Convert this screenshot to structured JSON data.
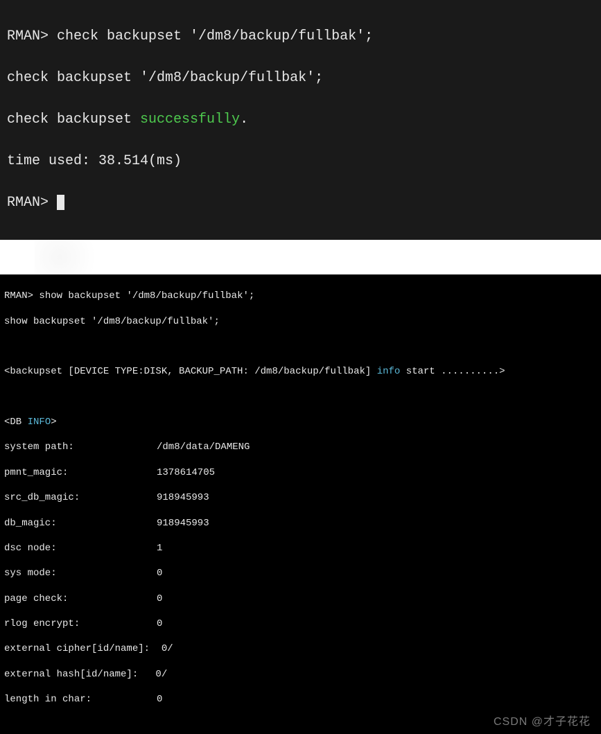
{
  "terminal1": {
    "line1_prompt": "RMAN> ",
    "line1_cmd": "check backupset '/dm8/backup/fullbak';",
    "line2": "check backupset '/dm8/backup/fullbak';",
    "line3_prefix": "check backupset ",
    "line3_success": "successfully",
    "line3_suffix": ".",
    "line4": "time used: 38.514(ms)",
    "line5_prompt": "RMAN> "
  },
  "terminal2": {
    "line1_prompt": "RMAN> ",
    "line1_cmd": "show backupset '/dm8/backup/fullbak';",
    "line2": "show backupset '/dm8/backup/fullbak';",
    "line3_prefix": "<backupset [DEVICE TYPE:DISK, BACKUP_PATH: /dm8/backup/fullbak] ",
    "line3_info": "info",
    "line3_suffix": " start ..........>",
    "db_header_prefix": "<DB ",
    "db_header_info": "INFO",
    "db_header_suffix": ">",
    "rows": [
      {
        "label": "system path:",
        "value": "/dm8/data/DAMENG"
      },
      {
        "label": "pmnt_magic:",
        "value": "1378614705"
      },
      {
        "label": "src_db_magic:",
        "value": "918945993"
      },
      {
        "label": "db_magic:",
        "value": "918945993"
      },
      {
        "label": "dsc node:",
        "value": "1"
      },
      {
        "label": "sys mode:",
        "value": "0"
      },
      {
        "label": "page check:",
        "value": "0"
      },
      {
        "label": "rlog encrypt:",
        "value": "0"
      }
    ],
    "extra_rows": [
      {
        "full": "external cipher[id/name]:  0/"
      },
      {
        "full": "external hash[id/name]:   0/"
      }
    ],
    "last_row": {
      "label": "length in char:",
      "value": "0"
    }
  },
  "watermark": "CSDN @才子花花"
}
